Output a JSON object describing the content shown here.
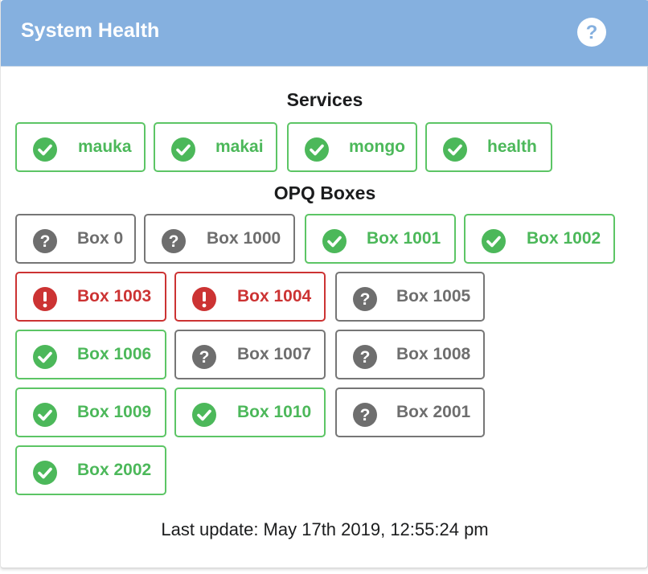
{
  "header": {
    "title": "System Health",
    "help_icon": "question-circle-icon"
  },
  "colors": {
    "header_bg": "#85b0df",
    "ok": "#4cb85a",
    "unknown": "#6e6e6e",
    "error": "#cc3333"
  },
  "services": {
    "title": "Services",
    "items": [
      {
        "label": "mauka",
        "status": "ok",
        "icon": "check-circle-icon"
      },
      {
        "label": "makai",
        "status": "ok",
        "icon": "check-circle-icon"
      },
      {
        "label": "mongo",
        "status": "ok",
        "icon": "check-circle-icon"
      },
      {
        "label": "health",
        "status": "ok",
        "icon": "check-circle-icon"
      }
    ]
  },
  "boxes": {
    "title": "OPQ Boxes",
    "items": [
      {
        "label": "Box 0",
        "status": "unknown",
        "icon": "question-circle-icon"
      },
      {
        "label": "Box 1000",
        "status": "unknown",
        "icon": "question-circle-icon"
      },
      {
        "label": "Box 1001",
        "status": "ok",
        "icon": "check-circle-icon"
      },
      {
        "label": "Box 1002",
        "status": "ok",
        "icon": "check-circle-icon"
      },
      {
        "label": "Box 1003",
        "status": "error",
        "icon": "exclamation-circle-icon"
      },
      {
        "label": "Box 1004",
        "status": "error",
        "icon": "exclamation-circle-icon"
      },
      {
        "label": "Box 1005",
        "status": "unknown",
        "icon": "question-circle-icon"
      },
      {
        "label": "Box 1006",
        "status": "ok",
        "icon": "check-circle-icon"
      },
      {
        "label": "Box 1007",
        "status": "unknown",
        "icon": "question-circle-icon"
      },
      {
        "label": "Box 1008",
        "status": "unknown",
        "icon": "question-circle-icon"
      },
      {
        "label": "Box 1009",
        "status": "ok",
        "icon": "check-circle-icon"
      },
      {
        "label": "Box 1010",
        "status": "ok",
        "icon": "check-circle-icon"
      },
      {
        "label": "Box 2001",
        "status": "unknown",
        "icon": "question-circle-icon"
      },
      {
        "label": "Box 2002",
        "status": "ok",
        "icon": "check-circle-icon"
      }
    ]
  },
  "footer": {
    "last_update": "Last update: May 17th 2019, 12:55:24 pm"
  }
}
